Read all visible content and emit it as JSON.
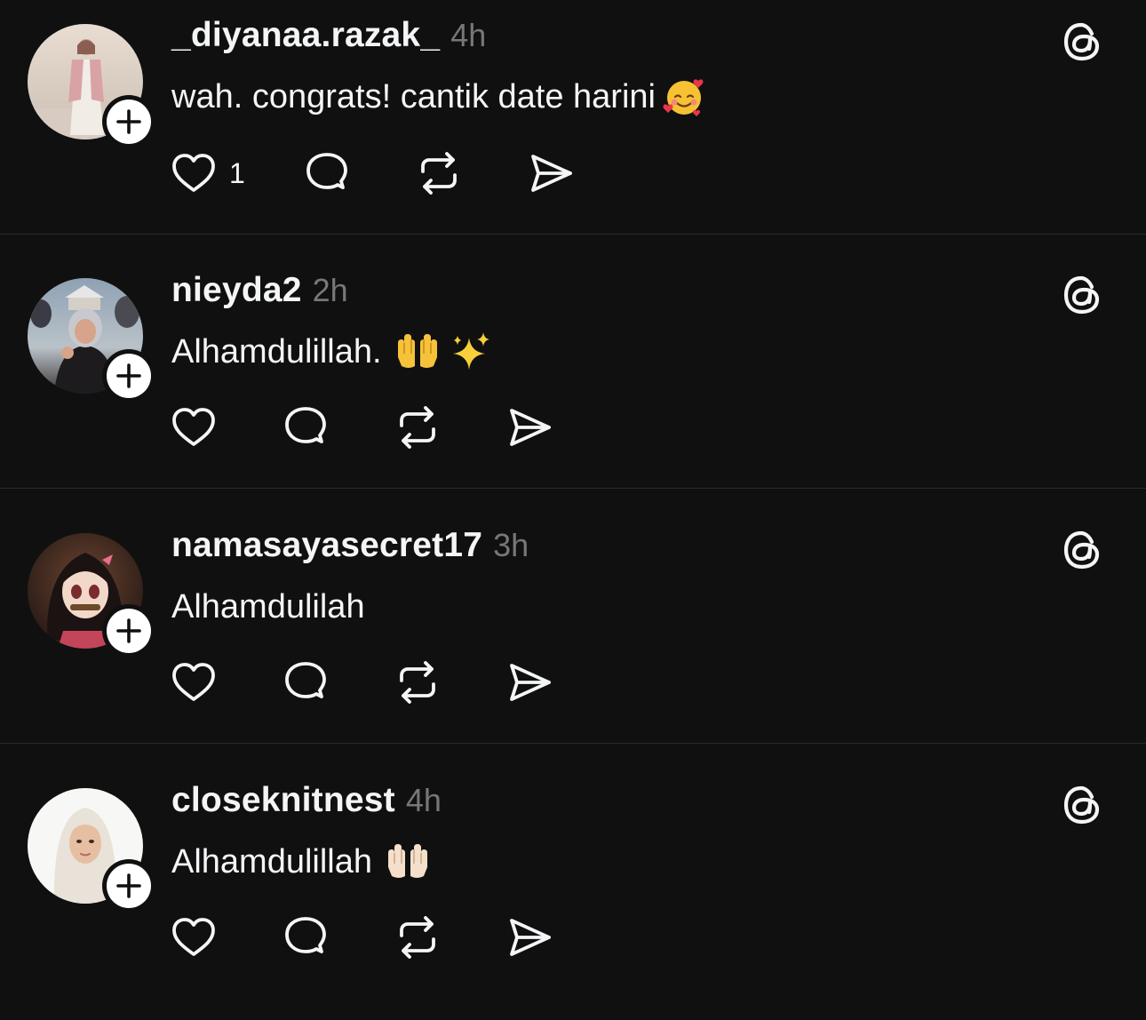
{
  "comments": [
    {
      "username": "_diyanaa.razak_",
      "time": "4h",
      "text": "wah. congrats! cantik date harini",
      "emoji": "smiling-face-with-hearts",
      "like_count": "1"
    },
    {
      "username": "nieyda2",
      "time": "2h",
      "text": "Alhamdulillah.",
      "emoji": "raised-hands-sparkles",
      "like_count": ""
    },
    {
      "username": "namasayasecret17",
      "time": "3h",
      "text": "Alhamdulilah",
      "emoji": "",
      "like_count": ""
    },
    {
      "username": "closeknitnest",
      "time": "4h",
      "text": "Alhamdulillah",
      "emoji": "palms-up-together",
      "like_count": ""
    }
  ],
  "icons": {
    "like": "heart-icon",
    "reply": "comment-icon",
    "repost": "repost-icon",
    "share": "send-icon",
    "follow": "plus-icon",
    "brand": "threads-logo-icon"
  },
  "colors": {
    "background": "#101010",
    "text": "#f3f5f7",
    "muted": "#777777",
    "divider": "#2a2a2a"
  }
}
